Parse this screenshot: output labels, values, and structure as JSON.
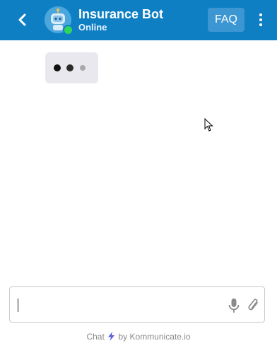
{
  "header": {
    "bot_name": "Insurance Bot",
    "status": "Online",
    "faq_label": "FAQ",
    "back_icon": "chevron-left-icon",
    "menu_icon": "more-vertical-icon",
    "avatar_icon": "robot-icon",
    "background_color": "#0f7fc4",
    "online_color": "#2fd65b"
  },
  "chat": {
    "typing_indicator": true,
    "typing_bubble_color": "#e9e8ee"
  },
  "composer": {
    "value": "",
    "placeholder": "",
    "mic_icon": "microphone-icon",
    "attach_icon": "paperclip-icon"
  },
  "footer": {
    "prefix": "Chat",
    "middle": "by",
    "brand": "Kommunicate.io",
    "bolt_icon": "lightning-icon",
    "bolt_color": "#5b5fe0"
  }
}
